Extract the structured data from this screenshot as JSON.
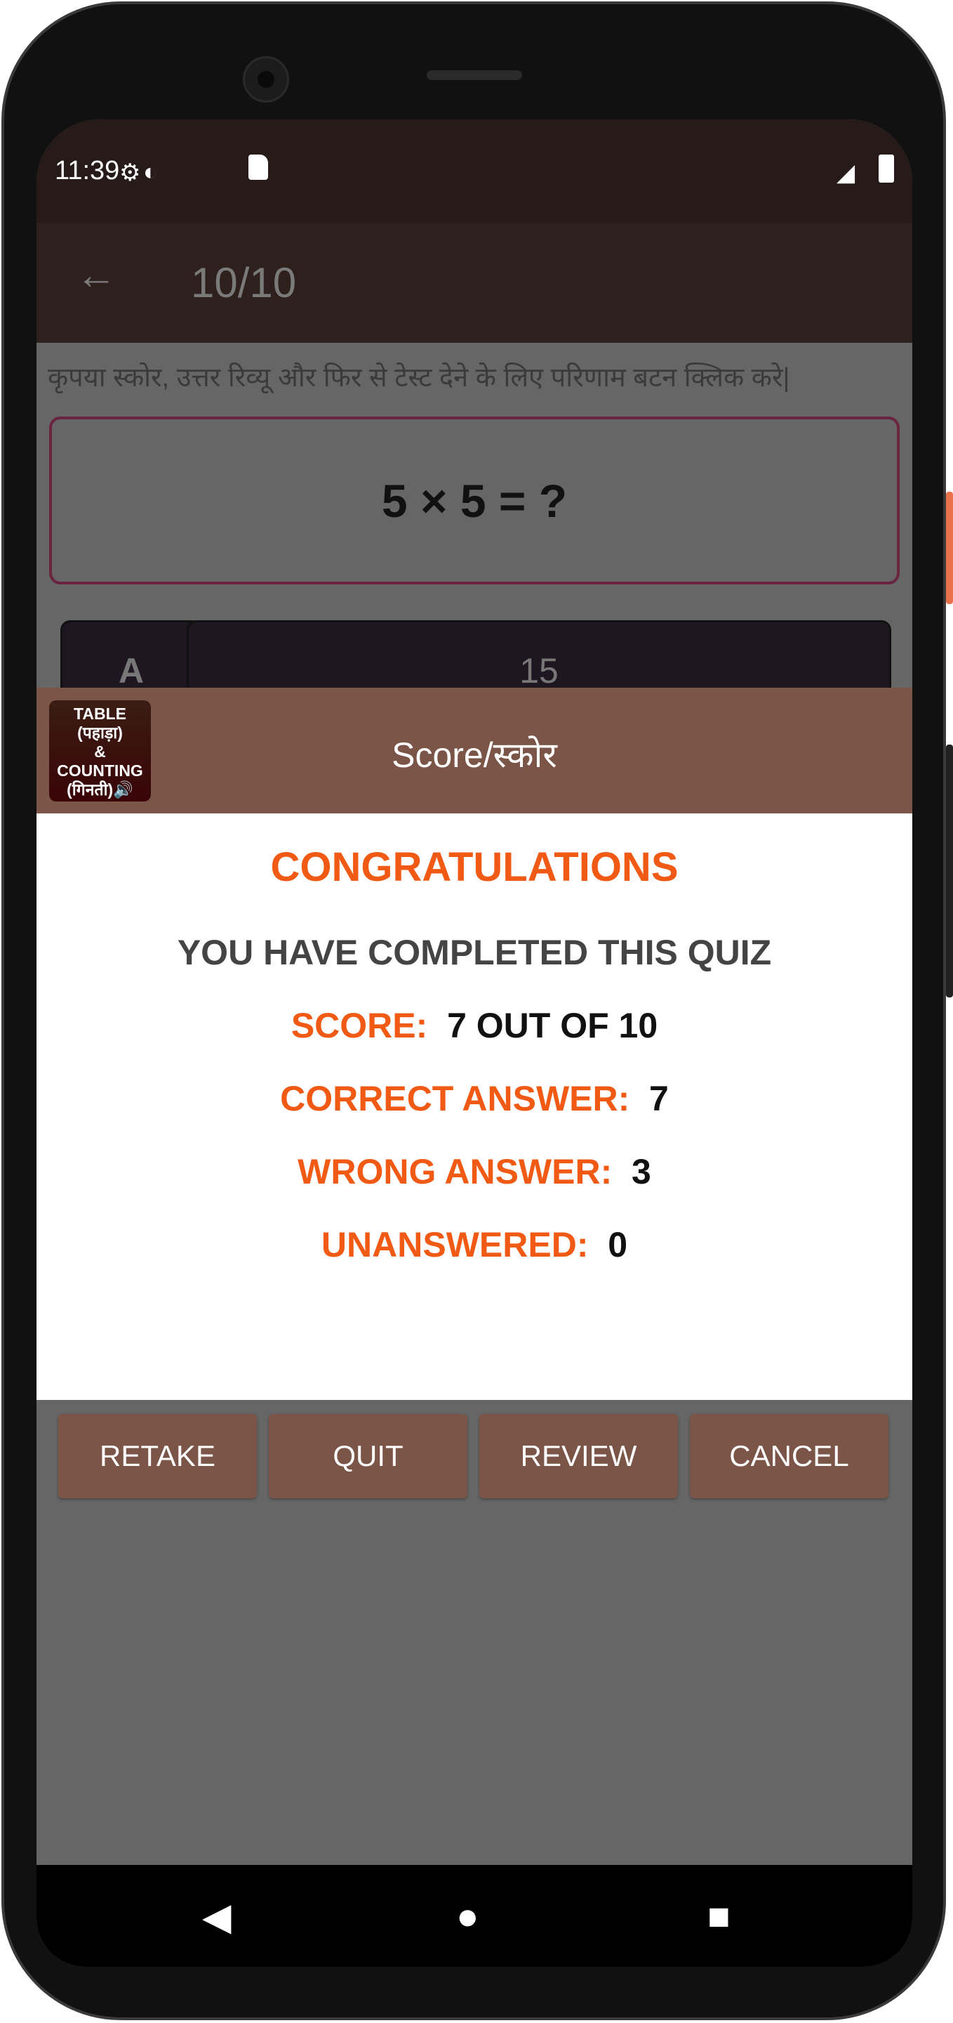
{
  "status_bar": {
    "time": "11:39",
    "icons": [
      "settings-wifi-icon",
      "vpn-key-icon",
      "sd-card-icon",
      "signal-off-icon",
      "battery-icon"
    ]
  },
  "app_bar": {
    "back_icon": "arrow-left-icon",
    "title": "10/10"
  },
  "quiz": {
    "hint": "कृपया स्कोर, उत्तर रिव्यू और फिर से टेस्ट देने के लिए परिणाम बटन क्लिक करे|",
    "question": "5 × 5 = ?",
    "option_letter": "A",
    "option_value": "15"
  },
  "dialog": {
    "logo": {
      "line1": "TABLE",
      "line2": "(पहाड़ा)",
      "line3": "&",
      "line4": "COUNTING",
      "line5": "(गिनती)🔊"
    },
    "title": "Score/स्कोर",
    "congrats": "CONGRATULATIONS",
    "completed": "YOU HAVE COMPLETED THIS QUIZ",
    "score_label": "SCORE:",
    "score_value": "7 OUT OF 10",
    "correct_label": "CORRECT ANSWER:",
    "correct_value": "7",
    "wrong_label": "WRONG ANSWER:",
    "wrong_value": "3",
    "unanswered_label": "UNANSWERED:",
    "unanswered_value": "0",
    "buttons": {
      "retake": "RETAKE",
      "quit": "QUIT",
      "review": "REVIEW",
      "cancel": "CANCEL"
    }
  },
  "nav_bar": {
    "back": "◀",
    "home": "●",
    "recents": "■"
  },
  "colors": {
    "accent": "#f05a14",
    "dialog_brand": "#7a5548",
    "status_bar": "#261b18",
    "app_bar": "#2e211d"
  }
}
